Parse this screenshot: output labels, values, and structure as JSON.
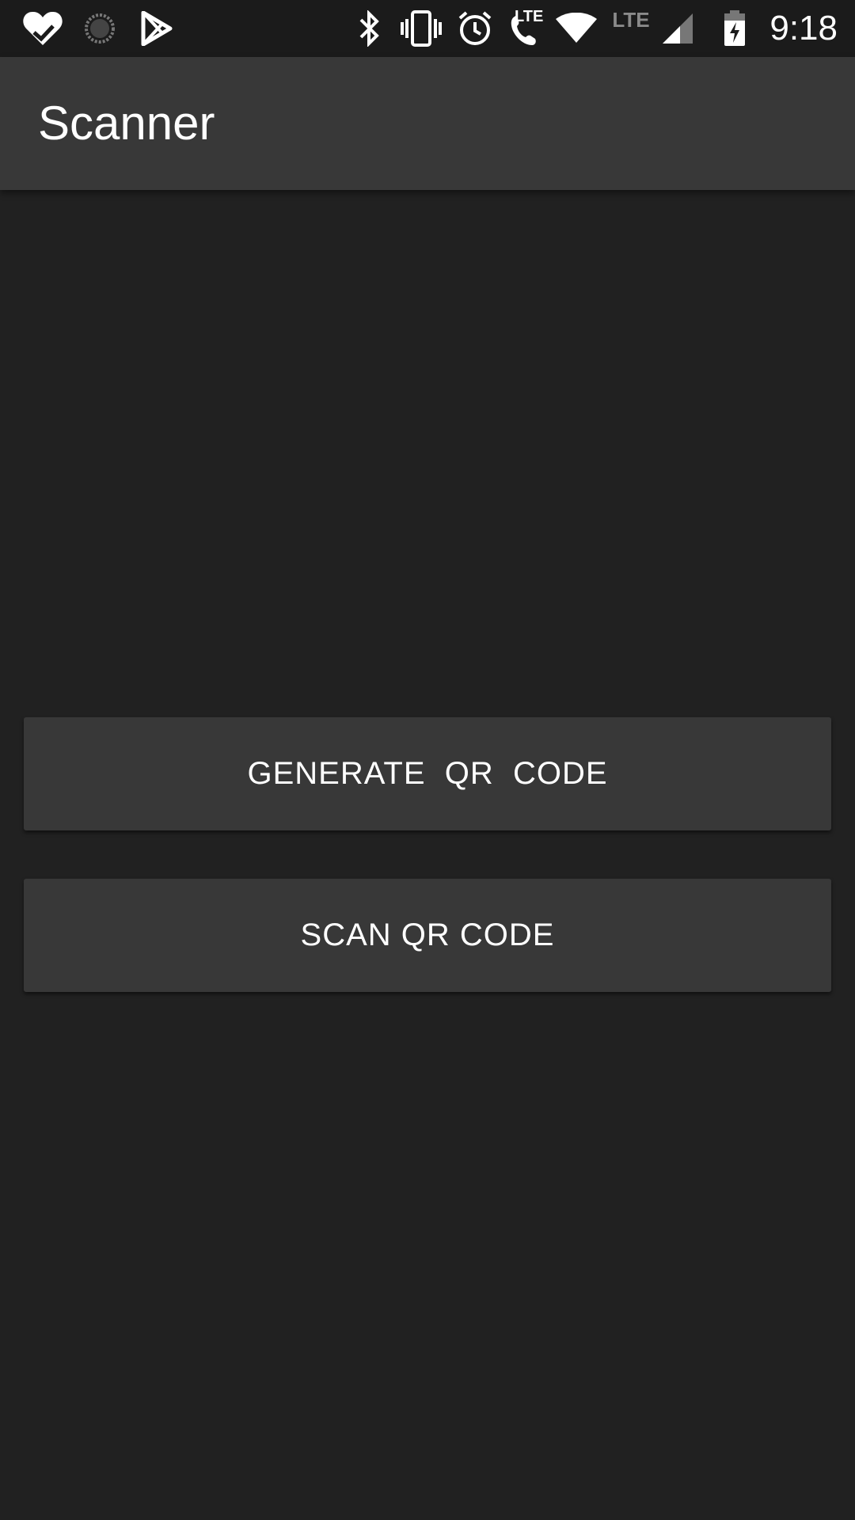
{
  "status_bar": {
    "time": "9:18",
    "icons": [
      "health-heart-check-icon",
      "loading-circle-icon",
      "play-store-icon",
      "bluetooth-icon",
      "vibrate-icon",
      "alarm-icon",
      "lte-call-icon",
      "wifi-icon",
      "lte-signal-icon",
      "cell-signal-icon",
      "battery-charging-icon"
    ],
    "lte_call_label": "LTE",
    "lte_label": "LTE"
  },
  "app_bar": {
    "title": "Scanner"
  },
  "buttons": {
    "generate_label": "GENERATE  QR  CODE",
    "scan_label": "SCAN QR CODE"
  },
  "colors": {
    "background": "#212121",
    "app_bar": "#383838",
    "button": "#383838",
    "text": "#ffffff"
  }
}
